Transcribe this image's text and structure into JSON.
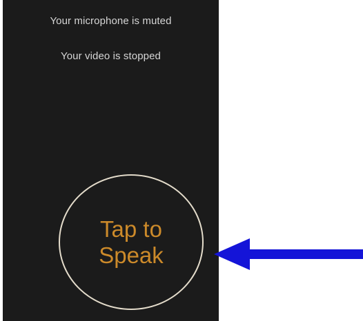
{
  "call_screen": {
    "mic_status": "Your microphone is muted",
    "video_status": "Your video is stopped",
    "speak_button": {
      "line1": "Tap to",
      "line2": "Speak"
    }
  },
  "annotation": {
    "arrow_color": "#1414d8",
    "arrow_icon": "left-arrow-icon"
  },
  "colors": {
    "screen_background": "#1b1b1b",
    "status_text": "#d6d6d6",
    "button_text": "#cc8a2a",
    "button_outline": "#e4dccb"
  }
}
